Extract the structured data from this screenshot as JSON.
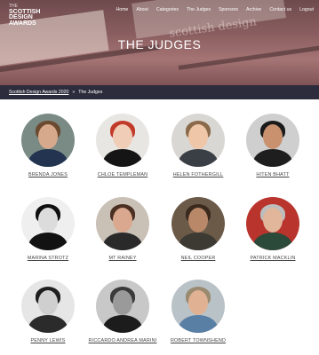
{
  "header": {
    "logo_lines": [
      "THE",
      "SCOTTISH",
      "DESIGN",
      "AWARDS"
    ],
    "nav": [
      "Home",
      "About",
      "Categories",
      "The Judges",
      "Sponsors",
      "Archive",
      "Contact us",
      "Logout"
    ],
    "title": "THE JUDGES",
    "hero_text": "scottish design"
  },
  "breadcrumb": {
    "home": "Scottish Design Awards 2020",
    "separator": "»",
    "current": "The Judges"
  },
  "judges": [
    {
      "name": "BRENDA JONES",
      "bg": "#7a8a84",
      "skin": "#d6a98c",
      "hair": "#6b4a2f",
      "top": "#22344f"
    },
    {
      "name": "CHLOE TEMPLEMAN",
      "bg": "#e8e6e2",
      "skin": "#f0cdb6",
      "hair": "#c23a2a",
      "top": "#151515"
    },
    {
      "name": "HELEN FOTHERGILL",
      "bg": "#d9d7d3",
      "skin": "#efc6a8",
      "hair": "#8a6a4a",
      "top": "#3a3f45"
    },
    {
      "name": "HITEN BHATT",
      "bg": "#cfcfcf",
      "skin": "#c9916e",
      "hair": "#1a1a1a",
      "top": "#1e1e1e"
    },
    {
      "name": "MARINA STROTZ",
      "bg": "#efefef",
      "skin": "#dcdcdc",
      "hair": "#101010",
      "top": "#121212"
    },
    {
      "name": "MT RAINEY",
      "bg": "#c9c0b6",
      "skin": "#d9a88e",
      "hair": "#4a2f22",
      "top": "#2a2a2a"
    },
    {
      "name": "NEIL COOPER",
      "bg": "#6b5a48",
      "skin": "#b98868",
      "hair": "#3a2a1e",
      "top": "#3d3a34"
    },
    {
      "name": "PATRICK MACKLIN",
      "bg": "#b8342c",
      "skin": "#e2b69b",
      "hair": "#bdbdbd",
      "top": "#2c4a3a"
    },
    {
      "name": "PENNY LEWIS",
      "bg": "#e6e6e6",
      "skin": "#cfcfcf",
      "hair": "#1f1f1f",
      "top": "#2b2b2b"
    },
    {
      "name": "RICCARDO ANDREA MARINI",
      "bg": "#c8c8c8",
      "skin": "#9a9a9a",
      "hair": "#3a3a3a",
      "top": "#1c1c1c"
    },
    {
      "name": "ROBERT TOWNSHEND",
      "bg": "#b9c2c7",
      "skin": "#e0b293",
      "hair": "#9a8a70",
      "top": "#5a7fa5"
    }
  ]
}
